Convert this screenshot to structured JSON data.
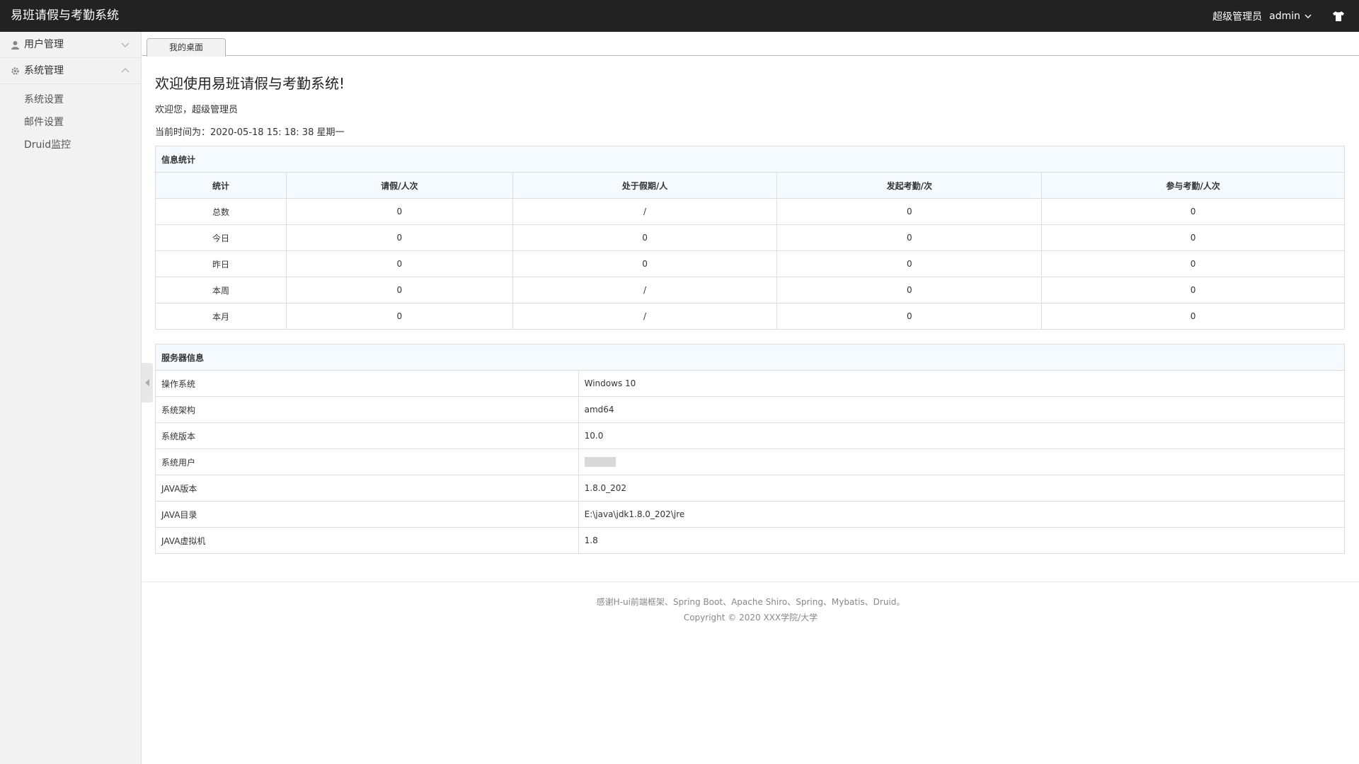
{
  "app": {
    "title": "易班请假与考勤系统",
    "role": "超级管理员",
    "username": "admin"
  },
  "icons": {
    "user_menu_caret": "chevron-down-icon",
    "skin": "tshirt-icon",
    "user_menu": "user-icon",
    "system_menu": "gear-icon"
  },
  "sidebar": {
    "menus": [
      {
        "label": "用户管理",
        "expanded": false
      },
      {
        "label": "系统管理",
        "expanded": true
      }
    ],
    "sub_items": [
      "系统设置",
      "邮件设置",
      "Druid监控"
    ]
  },
  "tabs": [
    {
      "label": "我的桌面"
    }
  ],
  "main": {
    "title": "欢迎使用易班请假与考勤系统!",
    "welcome": "欢迎您，超级管理员",
    "time_label": "当前时间为：",
    "time_value": "2020-05-18  15: 18: 38  星期一"
  },
  "stats": {
    "caption": "信息统计",
    "headers": [
      "统计",
      "请假/人次",
      "处于假期/人",
      "发起考勤/次",
      "参与考勤/人次"
    ],
    "rows": [
      [
        "总数",
        "0",
        "/",
        "0",
        "0"
      ],
      [
        "今日",
        "0",
        "0",
        "0",
        "0"
      ],
      [
        "昨日",
        "0",
        "0",
        "0",
        "0"
      ],
      [
        "本周",
        "0",
        "/",
        "0",
        "0"
      ],
      [
        "本月",
        "0",
        "/",
        "0",
        "0"
      ]
    ]
  },
  "server": {
    "caption": "服务器信息",
    "rows": [
      [
        "操作系统",
        "Windows 10"
      ],
      [
        "系统架构",
        "amd64"
      ],
      [
        "系统版本",
        "10.0"
      ],
      [
        "系统用户",
        ""
      ],
      [
        "JAVA版本",
        "1.8.0_202"
      ],
      [
        "JAVA目录",
        "E:\\java\\jdk1.8.0_202\\jre"
      ],
      [
        "JAVA虚拟机",
        "1.8"
      ]
    ]
  },
  "footer": {
    "line1": "感谢H-ui前端框架、Spring Boot、Apache Shiro、Spring、Mybatis、Druid。",
    "line2": "Copyright © 2020 XXX学院/大学"
  }
}
